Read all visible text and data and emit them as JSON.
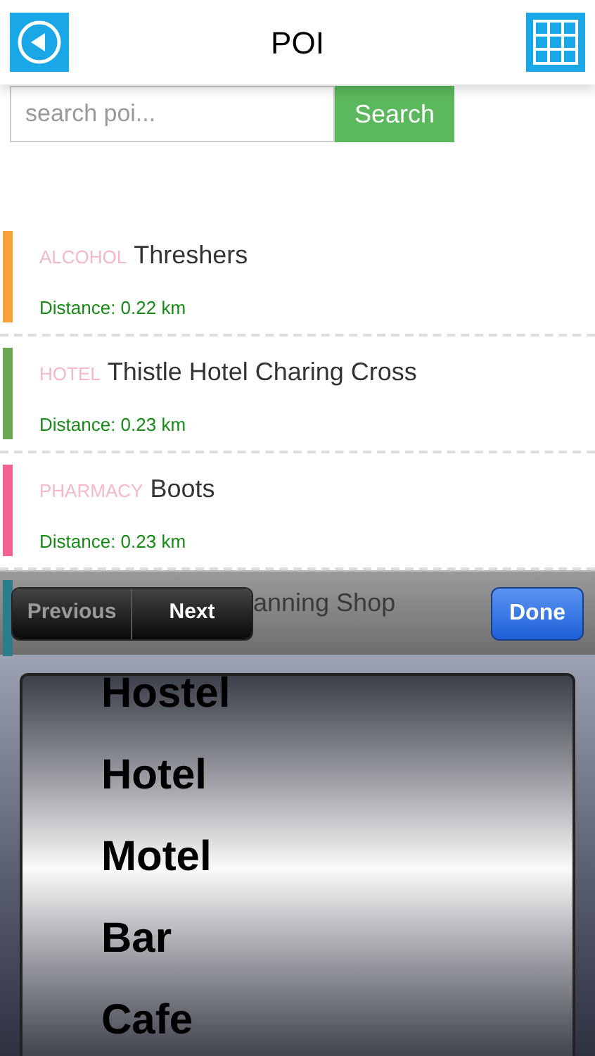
{
  "header": {
    "title": "POI"
  },
  "search": {
    "placeholder": "search poi...",
    "button": "Search"
  },
  "pois": [
    {
      "category": "ALCOHOL",
      "name": "Threshers",
      "distance": "Distance: 0.22 km",
      "color": "#f6a239"
    },
    {
      "category": "HOTEL",
      "name": "Thistle Hotel Charing Cross",
      "distance": "Distance: 0.23 km",
      "color": "#6aa84f"
    },
    {
      "category": "PHARMACY",
      "name": "Boots",
      "distance": "Distance: 0.23 km",
      "color": "#f06292"
    }
  ],
  "hidden_poi": {
    "name": "anning Shop",
    "color": "#2c7c8c"
  },
  "toolbar": {
    "previous": "Previous",
    "next": "Next",
    "done": "Done"
  },
  "picker": {
    "options": [
      "Hostel",
      "Hotel",
      "Motel",
      "Bar",
      "Cafe"
    ]
  }
}
